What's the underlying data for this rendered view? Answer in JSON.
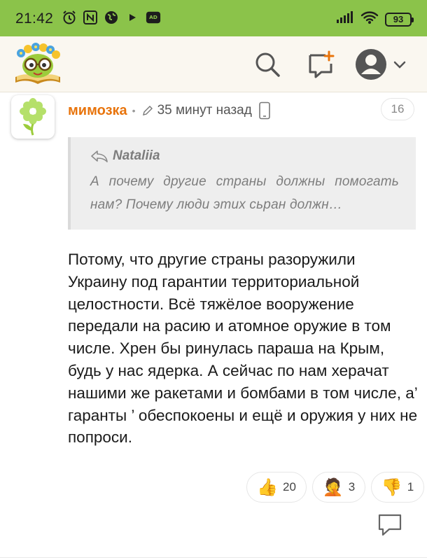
{
  "status_bar": {
    "time": "21:42",
    "battery": "93",
    "icons": [
      "alarm-icon",
      "nfc-icon",
      "globe-icon",
      "play-icon",
      "ad-icon",
      "signal-icon",
      "wifi-icon",
      "battery-icon"
    ]
  },
  "header": {
    "logo_icon": "owl-book-logo",
    "search_icon": "search-icon",
    "new_post_icon": "new-message-icon",
    "profile_icon": "user-avatar-icon"
  },
  "comment": {
    "username": "мимозка",
    "time": "35 минут назад",
    "count": "16",
    "quote": {
      "author": "Nataliia",
      "text": "А почему другие страны должны помогать нам? Почему люди этих сьран должн…"
    },
    "body": "Потому, что другие страны разоружили Украину под гарантии территориальной целостности. Всё тяжёлое вооружение передали на расию и атомное оружие в том числе. Хрен бы ринулась параша на Крым, будь у нас ядерка. А сейчас по нам херачат нашими же ракетами и бомбами в том числе, а’ гаранты ’ обеспокоены и ещё и оружия у них не попроси.",
    "reactions": [
      {
        "emoji": "👍",
        "count": "20",
        "name": "thumbs-up"
      },
      {
        "emoji": "🤦",
        "count": "3",
        "name": "facepalm"
      },
      {
        "emoji": "👎",
        "count": "1",
        "name": "thumbs-down"
      }
    ]
  },
  "colors": {
    "status_bar": "#8bc34a",
    "username": "#e8740c",
    "quote_bg": "#eeeeee",
    "header_bg": "#faf7f0"
  }
}
